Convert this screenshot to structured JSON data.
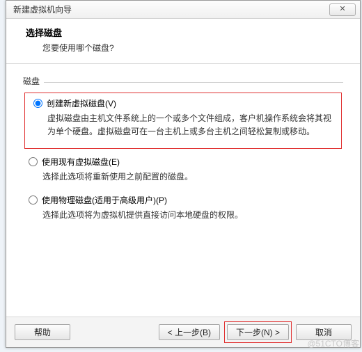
{
  "window": {
    "title": "新建虚拟机向导"
  },
  "header": {
    "title": "选择磁盘",
    "subtitle": "您要使用哪个磁盘?"
  },
  "group_label": "磁盘",
  "options": {
    "create": {
      "label": "创建新虚拟磁盘(V)",
      "desc": "虚拟磁盘由主机文件系统上的一个或多个文件组成，客户机操作系统会将其视为单个硬盘。虚拟磁盘可在一台主机上或多台主机之间轻松复制或移动。"
    },
    "existing": {
      "label": "使用现有虚拟磁盘(E)",
      "desc": "选择此选项将重新使用之前配置的磁盘。"
    },
    "physical": {
      "label": "使用物理磁盘(适用于高级用户)(P)",
      "desc": "选择此选项将为虚拟机提供直接访问本地硬盘的权限。"
    }
  },
  "buttons": {
    "help": "帮助",
    "back": "< 上一步(B)",
    "next": "下一步(N) >",
    "cancel": "取消"
  },
  "watermark": "@51CTO博客"
}
